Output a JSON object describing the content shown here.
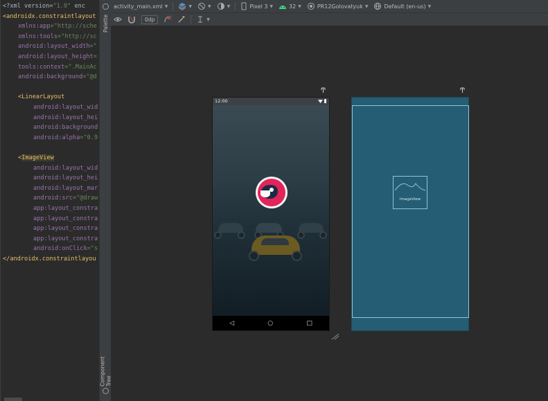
{
  "editor": {
    "lines": [
      {
        "parts": [
          {
            "t": "<?xml version=",
            "c": "pl"
          },
          {
            "t": "\"1.0\"",
            "c": "val"
          },
          {
            "t": " enc",
            "c": "pl"
          }
        ]
      },
      {
        "parts": [
          {
            "t": "<androidx.constraintlayout",
            "c": "tag"
          }
        ]
      },
      {
        "indent": 1,
        "parts": [
          {
            "t": "xmlns:",
            "c": "ns"
          },
          {
            "t": "app",
            "c": "attr"
          },
          {
            "t": "=\"http://sche",
            "c": "val"
          }
        ]
      },
      {
        "indent": 1,
        "parts": [
          {
            "t": "xmlns:",
            "c": "ns"
          },
          {
            "t": "tools",
            "c": "attr"
          },
          {
            "t": "=\"http://sc",
            "c": "val"
          }
        ]
      },
      {
        "indent": 1,
        "parts": [
          {
            "t": "android:",
            "c": "ns"
          },
          {
            "t": "layout_width",
            "c": "attr"
          },
          {
            "t": "=\"",
            "c": "val"
          }
        ]
      },
      {
        "indent": 1,
        "parts": [
          {
            "t": "android:",
            "c": "ns"
          },
          {
            "t": "layout_height",
            "c": "attr"
          },
          {
            "t": "=",
            "c": "val"
          }
        ]
      },
      {
        "indent": 1,
        "parts": [
          {
            "t": "tools:",
            "c": "ns"
          },
          {
            "t": "context",
            "c": "attr"
          },
          {
            "t": "=\".MainAc",
            "c": "val"
          }
        ]
      },
      {
        "indent": 1,
        "parts": [
          {
            "t": "android:",
            "c": "ns"
          },
          {
            "t": "background",
            "c": "attr"
          },
          {
            "t": "=\"@d",
            "c": "val"
          }
        ]
      },
      {
        "parts": []
      },
      {
        "indent": 1,
        "parts": [
          {
            "t": "<LinearLayout",
            "c": "tag"
          }
        ]
      },
      {
        "indent": 2,
        "parts": [
          {
            "t": "android:",
            "c": "ns"
          },
          {
            "t": "layout_wid",
            "c": "attr"
          }
        ]
      },
      {
        "indent": 2,
        "parts": [
          {
            "t": "android:",
            "c": "ns"
          },
          {
            "t": "layout_hei",
            "c": "attr"
          }
        ]
      },
      {
        "indent": 2,
        "parts": [
          {
            "t": "android:",
            "c": "ns"
          },
          {
            "t": "background",
            "c": "attr"
          }
        ]
      },
      {
        "indent": 2,
        "parts": [
          {
            "t": "android:",
            "c": "ns"
          },
          {
            "t": "alpha",
            "c": "attr"
          },
          {
            "t": "=\"0.9",
            "c": "val"
          }
        ]
      },
      {
        "parts": []
      },
      {
        "indent": 1,
        "parts": [
          {
            "t": "<",
            "c": "tag"
          },
          {
            "t": "ImageView",
            "c": "hl"
          }
        ]
      },
      {
        "indent": 2,
        "parts": [
          {
            "t": "android:",
            "c": "ns"
          },
          {
            "t": "layout_wid",
            "c": "attr"
          }
        ]
      },
      {
        "indent": 2,
        "parts": [
          {
            "t": "android:",
            "c": "ns"
          },
          {
            "t": "layout_hei",
            "c": "attr"
          }
        ]
      },
      {
        "indent": 2,
        "parts": [
          {
            "t": "android:",
            "c": "ns"
          },
          {
            "t": "layout_mar",
            "c": "attr"
          }
        ]
      },
      {
        "indent": 2,
        "parts": [
          {
            "t": "android:",
            "c": "ns"
          },
          {
            "t": "src",
            "c": "attr"
          },
          {
            "t": "=\"@draw",
            "c": "val"
          }
        ]
      },
      {
        "indent": 2,
        "parts": [
          {
            "t": "app:",
            "c": "ns"
          },
          {
            "t": "layout_constra",
            "c": "attr"
          }
        ]
      },
      {
        "indent": 2,
        "parts": [
          {
            "t": "app:",
            "c": "ns"
          },
          {
            "t": "layout_constra",
            "c": "attr"
          }
        ]
      },
      {
        "indent": 2,
        "parts": [
          {
            "t": "app:",
            "c": "ns"
          },
          {
            "t": "layout_constra",
            "c": "attr"
          }
        ]
      },
      {
        "indent": 2,
        "parts": [
          {
            "t": "app:",
            "c": "ns"
          },
          {
            "t": "layout_constra",
            "c": "attr"
          }
        ]
      },
      {
        "indent": 2,
        "parts": [
          {
            "t": "android:",
            "c": "ns"
          },
          {
            "t": "onClick",
            "c": "attr"
          },
          {
            "t": "=\"s",
            "c": "val"
          }
        ]
      },
      {
        "parts": [
          {
            "t": "</androidx.constraintlayou",
            "c": "tag"
          }
        ]
      }
    ]
  },
  "side_tabs": {
    "palette": "Palette",
    "component_tree": "Component Tree"
  },
  "toolbar": {
    "file": "activity_main.xml",
    "device": "Pixel 3",
    "api": "32",
    "theme": "PR12Golovatyuk",
    "locale": "Default (en-us)",
    "margin": "0dp"
  },
  "phone": {
    "time": "12:00"
  },
  "blueprint": {
    "imageview_label": "ImageView"
  },
  "colors": {
    "accent": "#e1245a",
    "blueprint": "#245d74",
    "blueprint_line": "#8ec8d8"
  }
}
